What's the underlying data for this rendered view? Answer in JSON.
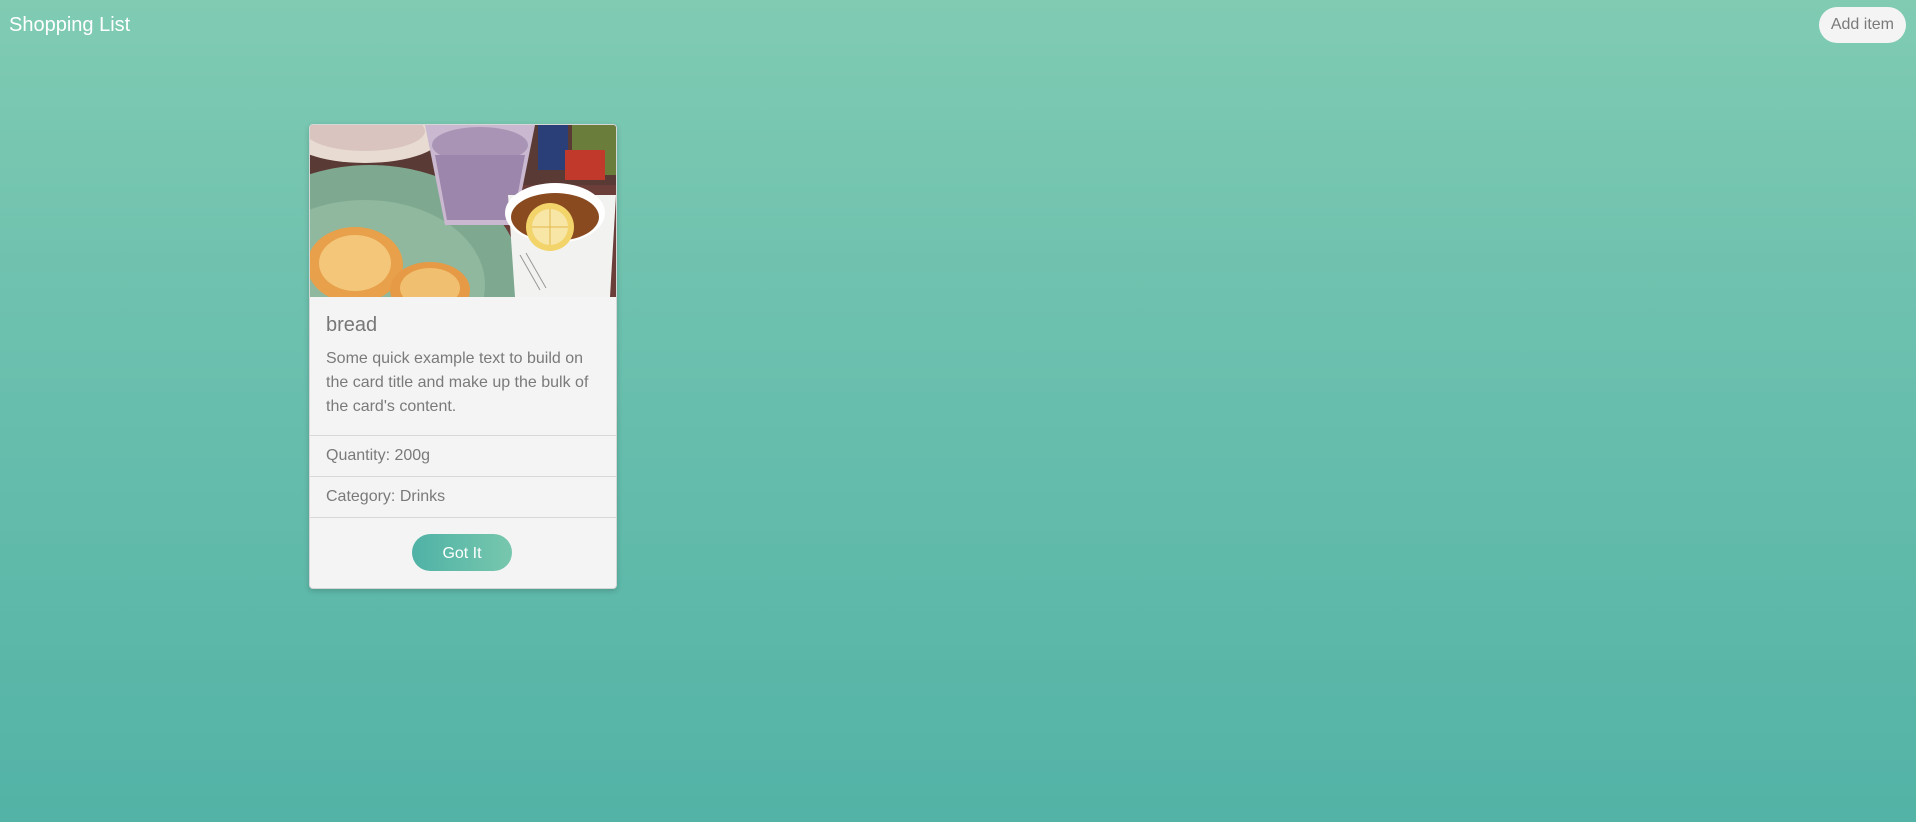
{
  "navbar": {
    "title": "Shopping List",
    "add_button_label": "Add item"
  },
  "colors": {
    "background_top": "#80cbb2",
    "background_bottom": "#52b3a6",
    "card_background": "#f4f4f4",
    "button_gradient_start": "#4fb2a6",
    "button_gradient_end": "#77c7ad"
  },
  "items": [
    {
      "image_icon": "food-photo-image",
      "title": "bread",
      "description": "Some quick example text to build on the card title and make up the bulk of the card's content.",
      "quantity": "Quantity: 200g",
      "category": "Category: Drinks",
      "action_label": "Got It"
    }
  ]
}
